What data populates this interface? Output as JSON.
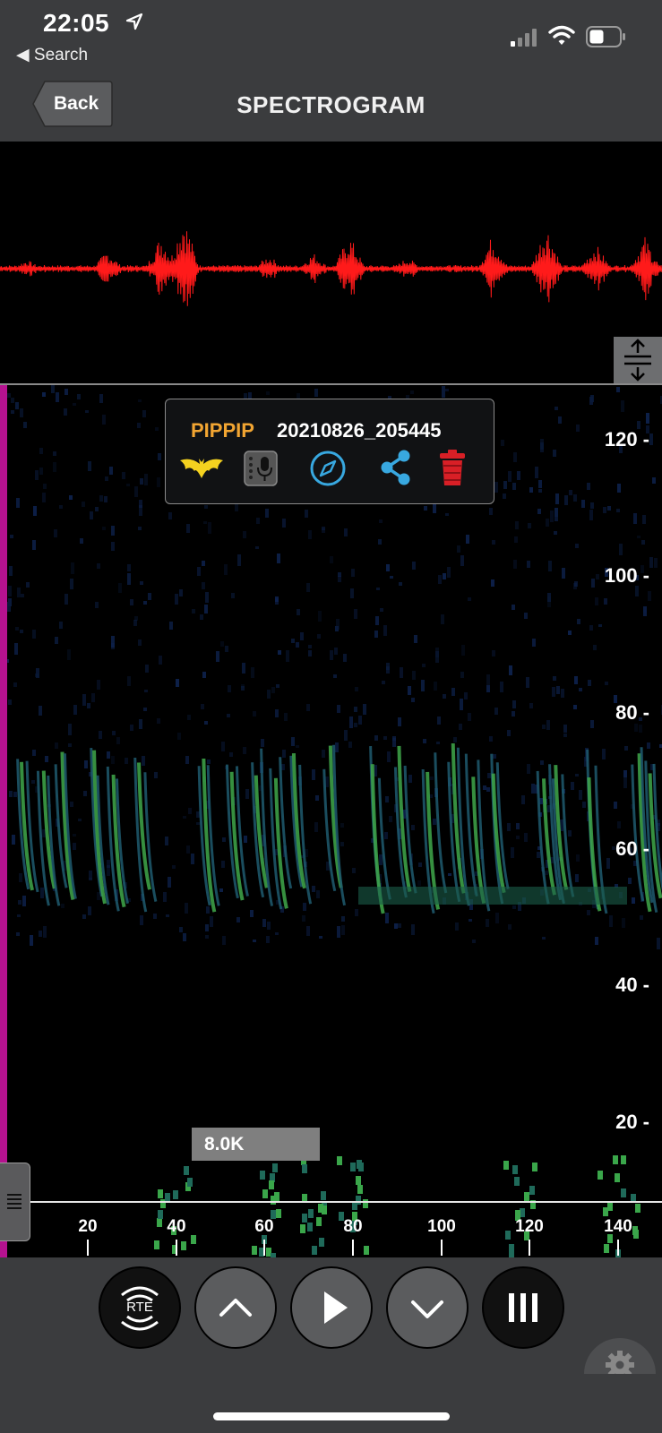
{
  "status": {
    "time": "22:05",
    "back_app": "◀ Search"
  },
  "nav": {
    "back_label": "Back",
    "title": "SPECTROGRAM"
  },
  "recording": {
    "species": "PIPPIP",
    "filename": "20210826_205445"
  },
  "freq_axis": {
    "labels": [
      "120 -",
      "100 -",
      "80 -",
      "60 -",
      "40 -",
      "20 -"
    ]
  },
  "time_axis": {
    "labels": [
      "20",
      "40",
      "60",
      "80",
      "100",
      "120",
      "140"
    ]
  },
  "zoom": {
    "label": "8.0K"
  },
  "controls": {
    "rte_label": "RTE"
  },
  "colors": {
    "waveform": "#ff1a1a",
    "species": "#f2a532",
    "accent_blue": "#38a8e0",
    "trash_red": "#d81f26",
    "bat_yellow": "#f5d21f",
    "magenta": "#b5128f"
  },
  "icons": [
    "location-arrow-icon",
    "signal-icon",
    "wifi-icon",
    "battery-icon",
    "resize-vertical-icon",
    "bat-icon",
    "recorder-icon",
    "compass-icon",
    "share-icon",
    "trash-icon",
    "rte-icon",
    "chevron-up-icon",
    "play-icon",
    "chevron-down-icon",
    "pause-icon",
    "gear-icon",
    "drag-handle-icon"
  ]
}
